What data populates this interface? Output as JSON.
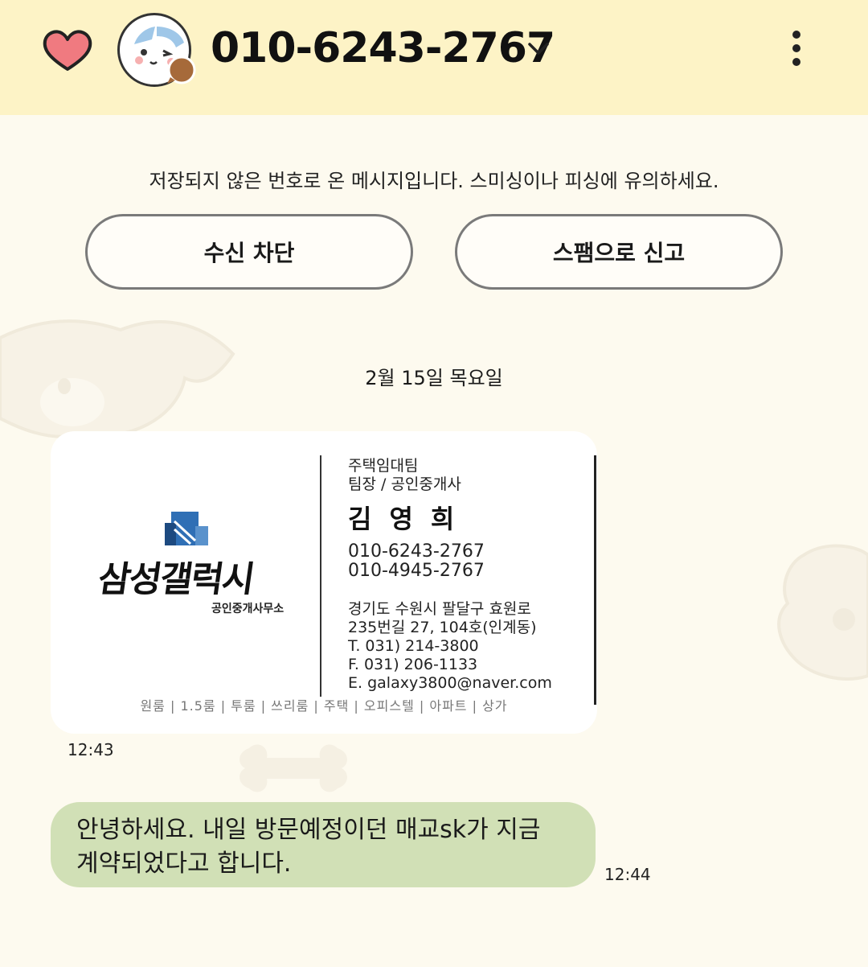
{
  "header": {
    "contact_name": "010-6243-2767",
    "favorite_icon": "heart-icon",
    "avatar_icon": "cat-avatar-icon",
    "dropdown_icon": "chevron-down-icon",
    "menu_icon": "more-vertical-icon"
  },
  "notice": {
    "text": "저장되지 않은 번호로 온 메시지입니다. 스미싱이나 피싱에 유의하세요.",
    "block_button": "수신 차단",
    "report_button": "스팸으로 신고"
  },
  "conversation": {
    "date_separator": "2월 15일 목요일",
    "messages": [
      {
        "type": "image",
        "time": "12:43",
        "card": {
          "logo_text": "삼성갤럭시",
          "logo_sub": "공인중개사무소",
          "team": "주택임대팀",
          "title": "팀장 / 공인중개사",
          "name": "김영희",
          "phone1": "010-6243-2767",
          "phone2": "010-4945-2767",
          "address1": "경기도 수원시 팔달구 효원로",
          "address2": "235번길 27, 104호(인계동)",
          "tel": "T. 031) 214-3800",
          "fax": "F. 031) 206-1133",
          "email": "E. galaxy3800@naver.com",
          "footer": "원룸  |  1.5룸  |  투룸  |  쓰리룸  |  주택  |  오피스텔  |  아파트  |  상가"
        }
      },
      {
        "type": "text",
        "time": "12:44",
        "line1": "안녕하세요. 내일 방문예정이던 매교sk가 지금",
        "line2": "계약되었다고 합니다."
      }
    ]
  },
  "colors": {
    "header_bg": "#fdf3c6",
    "page_bg": "#fdfaef",
    "bubble_bg": "#d1e0b6",
    "heart": "#f07a80"
  }
}
